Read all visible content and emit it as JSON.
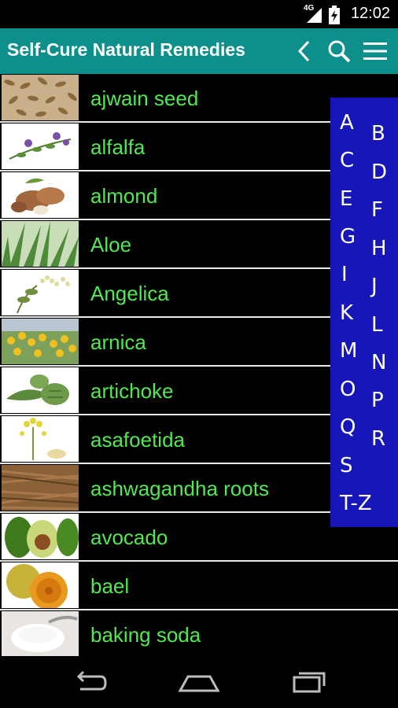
{
  "status_bar": {
    "network": "4G",
    "time": "12:02"
  },
  "app_bar": {
    "title": "Self-Cure Natural Remedies"
  },
  "icons": {
    "back": "back-chevron-icon",
    "search": "search-icon",
    "menu": "hamburger-menu-icon"
  },
  "list": {
    "items": [
      {
        "label": "ajwain seed"
      },
      {
        "label": "alfalfa"
      },
      {
        "label": "almond"
      },
      {
        "label": "Aloe"
      },
      {
        "label": "Angelica"
      },
      {
        "label": "arnica"
      },
      {
        "label": "artichoke"
      },
      {
        "label": "asafoetida"
      },
      {
        "label": "ashwagandha roots"
      },
      {
        "label": "avocado"
      },
      {
        "label": "bael"
      },
      {
        "label": "baking soda"
      }
    ]
  },
  "alpha_index": {
    "letters": [
      "A",
      "B",
      "C",
      "D",
      "E",
      "F",
      "G",
      "H",
      "I",
      "J",
      "K",
      "L",
      "M",
      "N",
      "O",
      "P",
      "Q",
      "R",
      "S",
      "T-Z"
    ]
  },
  "colors": {
    "app_bar": "#0d8f8b",
    "label_green": "#52e852",
    "index_blue": "#1717b9"
  }
}
